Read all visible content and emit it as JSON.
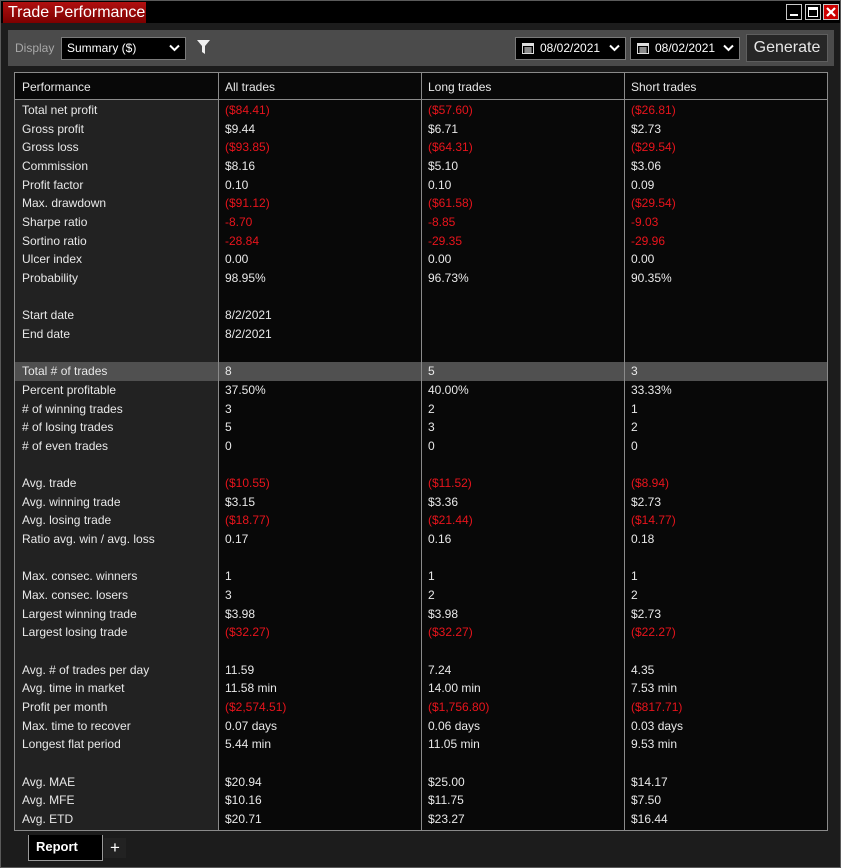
{
  "window": {
    "title": "Trade Performance"
  },
  "toolbar": {
    "display_label": "Display",
    "display_value": "Summary ($)",
    "start_date": "08/02/2021",
    "end_date": "08/02/2021",
    "generate_label": "Generate"
  },
  "table": {
    "headers": [
      "Performance",
      "All trades",
      "Long trades",
      "Short trades"
    ],
    "rows": [
      {
        "label": "Total net profit",
        "all": "($84.41)",
        "long": "($57.60)",
        "short": "($26.81)",
        "neg": true
      },
      {
        "label": "Gross profit",
        "all": "$9.44",
        "long": "$6.71",
        "short": "$2.73"
      },
      {
        "label": "Gross loss",
        "all": "($93.85)",
        "long": "($64.31)",
        "short": "($29.54)",
        "neg": true
      },
      {
        "label": "Commission",
        "all": "$8.16",
        "long": "$5.10",
        "short": "$3.06"
      },
      {
        "label": "Profit factor",
        "all": "0.10",
        "long": "0.10",
        "short": "0.09"
      },
      {
        "label": "Max. drawdown",
        "all": "($91.12)",
        "long": "($61.58)",
        "short": "($29.54)",
        "neg": true
      },
      {
        "label": "Sharpe ratio",
        "all": "-8.70",
        "long": "-8.85",
        "short": "-9.03",
        "neg": true
      },
      {
        "label": "Sortino ratio",
        "all": "-28.84",
        "long": "-29.35",
        "short": "-29.96",
        "neg": true
      },
      {
        "label": "Ulcer index",
        "all": "0.00",
        "long": "0.00",
        "short": "0.00"
      },
      {
        "label": "Probability",
        "all": "98.95%",
        "long": "96.73%",
        "short": "90.35%"
      },
      {
        "label": "",
        "all": "",
        "long": "",
        "short": ""
      },
      {
        "label": "Start date",
        "all": "8/2/2021",
        "long": "",
        "short": ""
      },
      {
        "label": "End date",
        "all": "8/2/2021",
        "long": "",
        "short": ""
      },
      {
        "label": "",
        "all": "",
        "long": "",
        "short": ""
      },
      {
        "label": "Total # of trades",
        "all": "8",
        "long": "5",
        "short": "3",
        "hl": true
      },
      {
        "label": "Percent profitable",
        "all": "37.50%",
        "long": "40.00%",
        "short": "33.33%"
      },
      {
        "label": "# of winning trades",
        "all": "3",
        "long": "2",
        "short": "1"
      },
      {
        "label": "# of losing trades",
        "all": "5",
        "long": "3",
        "short": "2"
      },
      {
        "label": "# of even trades",
        "all": "0",
        "long": "0",
        "short": "0"
      },
      {
        "label": "",
        "all": "",
        "long": "",
        "short": ""
      },
      {
        "label": "Avg. trade",
        "all": "($10.55)",
        "long": "($11.52)",
        "short": "($8.94)",
        "neg": true
      },
      {
        "label": "Avg. winning trade",
        "all": "$3.15",
        "long": "$3.36",
        "short": "$2.73"
      },
      {
        "label": "Avg. losing trade",
        "all": "($18.77)",
        "long": "($21.44)",
        "short": "($14.77)",
        "neg": true
      },
      {
        "label": "Ratio avg. win / avg. loss",
        "all": "0.17",
        "long": "0.16",
        "short": "0.18"
      },
      {
        "label": "",
        "all": "",
        "long": "",
        "short": ""
      },
      {
        "label": "Max. consec. winners",
        "all": "1",
        "long": "1",
        "short": "1"
      },
      {
        "label": "Max. consec. losers",
        "all": "3",
        "long": "2",
        "short": "2"
      },
      {
        "label": "Largest winning trade",
        "all": "$3.98",
        "long": "$3.98",
        "short": "$2.73"
      },
      {
        "label": "Largest losing trade",
        "all": "($32.27)",
        "long": "($32.27)",
        "short": "($22.27)",
        "neg": true
      },
      {
        "label": "",
        "all": "",
        "long": "",
        "short": ""
      },
      {
        "label": "Avg. # of trades per day",
        "all": "11.59",
        "long": "7.24",
        "short": "4.35"
      },
      {
        "label": "Avg. time in market",
        "all": "11.58 min",
        "long": "14.00 min",
        "short": "7.53 min"
      },
      {
        "label": "Profit per month",
        "all": "($2,574.51)",
        "long": "($1,756.80)",
        "short": "($817.71)",
        "neg": true
      },
      {
        "label": "Max. time to recover",
        "all": "0.07 days",
        "long": "0.06 days",
        "short": "0.03 days"
      },
      {
        "label": "Longest flat period",
        "all": "5.44 min",
        "long": "11.05 min",
        "short": "9.53 min"
      },
      {
        "label": "",
        "all": "",
        "long": "",
        "short": ""
      },
      {
        "label": "Avg. MAE",
        "all": "$20.94",
        "long": "$25.00",
        "short": "$14.17"
      },
      {
        "label": "Avg. MFE",
        "all": "$10.16",
        "long": "$11.75",
        "short": "$7.50"
      },
      {
        "label": "Avg. ETD",
        "all": "$20.71",
        "long": "$23.27",
        "short": "$16.44"
      }
    ]
  },
  "tabs": {
    "report_label": "Report",
    "add_label": "+"
  },
  "colors": {
    "negative": "#e8141c",
    "title_bar": "#a00000",
    "highlight_row": "#505050"
  }
}
